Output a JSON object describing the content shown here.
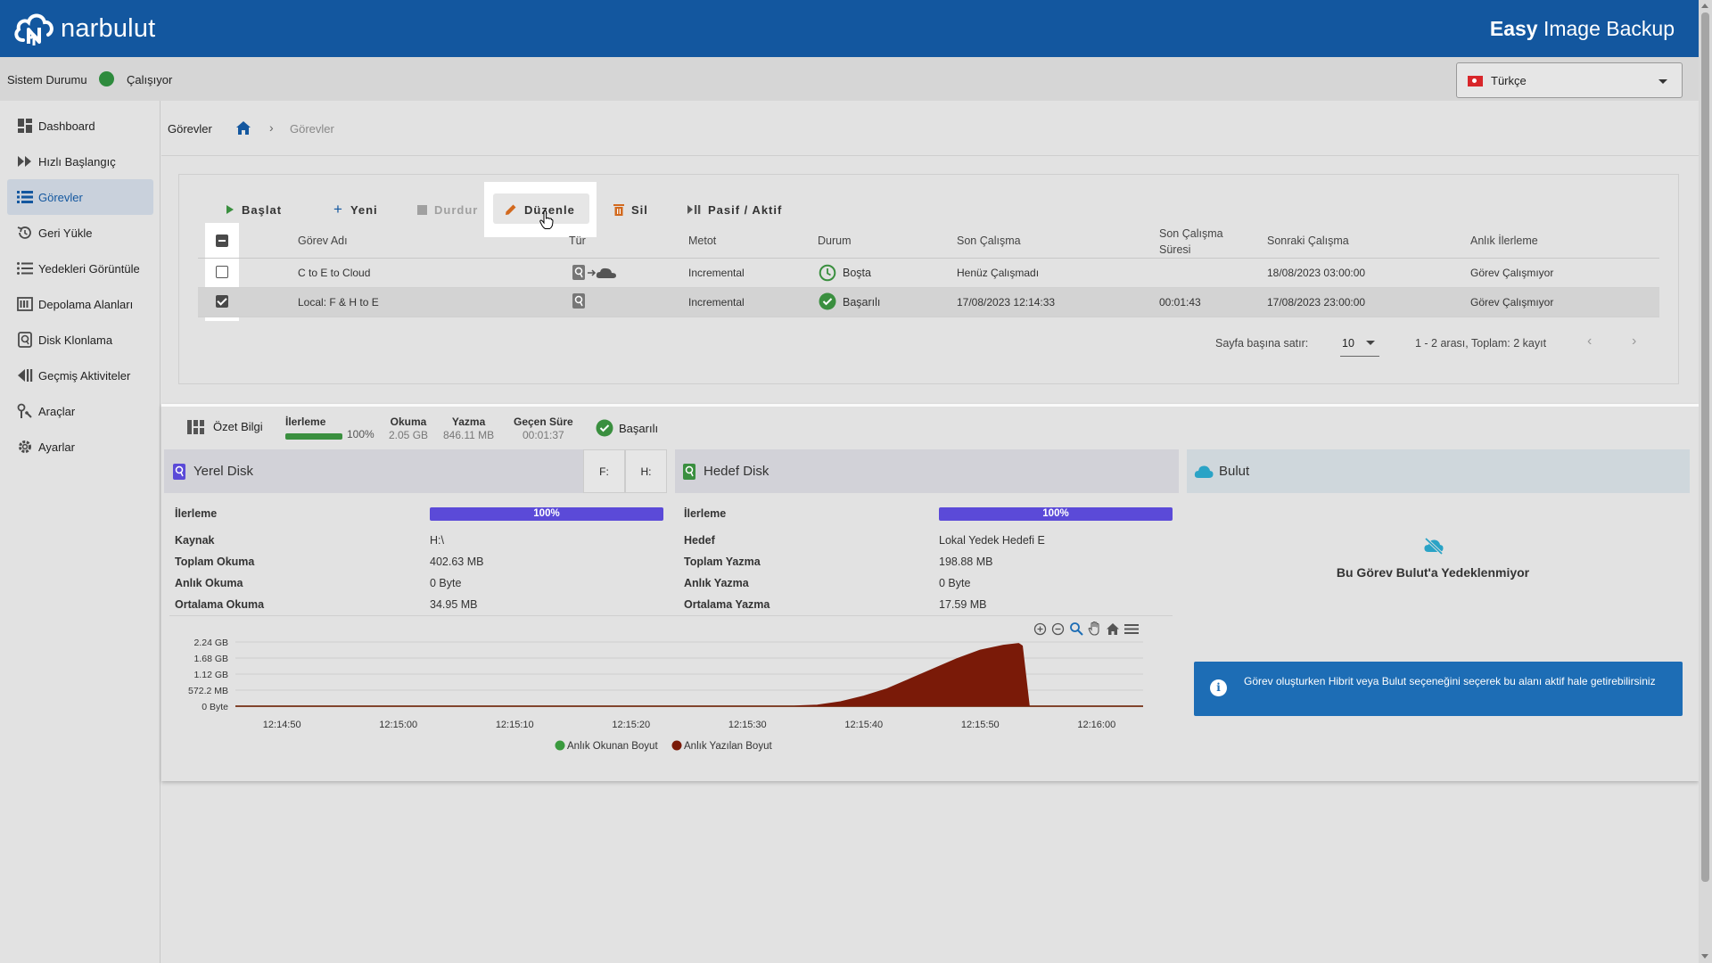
{
  "header": {
    "logo_text": "narbulut",
    "app_title_bold": "Easy",
    "app_title_rest": " Image Backup"
  },
  "status": {
    "label": "Sistem Durumu",
    "state": "Çalışıyor",
    "state_color": "#2e8b3d"
  },
  "language": {
    "selected": "Türkçe"
  },
  "sidebar": {
    "items": [
      {
        "label": "Dashboard",
        "icon": "dashboard-icon"
      },
      {
        "label": "Hızlı Başlangıç",
        "icon": "fast-forward-icon"
      },
      {
        "label": "Görevler",
        "icon": "list-icon",
        "active": true
      },
      {
        "label": "Geri Yükle",
        "icon": "restore-icon"
      },
      {
        "label": "Yedekleri Görüntüle",
        "icon": "view-list-icon"
      },
      {
        "label": "Depolama Alanları",
        "icon": "storage-icon"
      },
      {
        "label": "Disk Klonlama",
        "icon": "disk-icon"
      },
      {
        "label": "Geçmiş Aktiviteler",
        "icon": "history-icon"
      },
      {
        "label": "Araçlar",
        "icon": "tools-icon"
      },
      {
        "label": "Ayarlar",
        "icon": "settings-icon"
      }
    ]
  },
  "breadcrumb": {
    "title": "Görevler",
    "current": "Görevler"
  },
  "toolbar": {
    "start": "Başlat",
    "new": "Yeni",
    "stop": "Durdur",
    "edit": "Düzenle",
    "delete": "Sil",
    "toggle": "Pasif / Aktif"
  },
  "table": {
    "headers": {
      "name": "Görev Adı",
      "type": "Tür",
      "method": "Metot",
      "status": "Durum",
      "last_run": "Son Çalışma",
      "last_duration_1": "Son Çalışma",
      "last_duration_2": "Süresi",
      "next_run": "Sonraki Çalışma",
      "progress": "Anlık İlerleme"
    },
    "rows": [
      {
        "checked": false,
        "name": "C to E to Cloud",
        "method": "Incremental",
        "status": "Boşta",
        "last_run": "Henüz Çalışmadı",
        "duration": "",
        "next_run": "18/08/2023 03:00:00",
        "progress": "Görev Çalışmıyor"
      },
      {
        "checked": true,
        "name": "Local: F & H to E",
        "method": "Incremental",
        "status": "Başarılı",
        "last_run": "17/08/2023 12:14:33",
        "duration": "00:01:43",
        "next_run": "17/08/2023 23:00:00",
        "progress": "Görev Çalışmıyor"
      }
    ],
    "rows_per_page_label": "Sayfa başına satır:",
    "rows_per_page": "10",
    "page_info": "1 - 2 arası, Toplam: 2 kayıt"
  },
  "summary": {
    "title": "Özet Bilgi",
    "progress_label": "İlerleme",
    "progress_value": "100%",
    "progress_fraction": 1.0,
    "read_label": "Okuma",
    "read_value": "2.05 GB",
    "write_label": "Yazma",
    "write_value": "846.11 MB",
    "elapsed_label": "Geçen Süre",
    "elapsed_value": "00:01:37",
    "result": "Başarılı"
  },
  "local_disk": {
    "title": "Yerel Disk",
    "drives": [
      "F:",
      "H:"
    ],
    "progress_label": "İlerleme",
    "progress_value": "100%",
    "source_label": "Kaynak",
    "source": "H:\\",
    "total_read_label": "Toplam Okuma",
    "total_read": "402.63 MB",
    "instant_read_label": "Anlık Okuma",
    "instant_read": "0 Byte",
    "avg_read_label": "Ortalama Okuma",
    "avg_read": "34.95 MB"
  },
  "target_disk": {
    "title": "Hedef Disk",
    "progress_label": "İlerleme",
    "progress_value": "100%",
    "target_label": "Hedef",
    "target": "Lokal Yedek Hedefi E",
    "total_write_label": "Toplam Yazma",
    "total_write": "198.88 MB",
    "instant_write_label": "Anlık Yazma",
    "instant_write": "0 Byte",
    "avg_write_label": "Ortalama Yazma",
    "avg_write": "17.59 MB"
  },
  "cloud": {
    "title": "Bulut",
    "message": "Bu Görev Bulut'a Yedeklenmiyor",
    "info": "Görev oluşturken Hibrit veya Bulut seçeneğini seçerek bu alanı aktif hale getirebilirsiniz"
  },
  "chart_data": {
    "type": "area",
    "x_ticks": [
      "12:14:50",
      "12:15:00",
      "12:15:10",
      "12:15:20",
      "12:15:30",
      "12:15:40",
      "12:15:50",
      "12:16:00"
    ],
    "y_ticks": [
      "2.24 GB",
      "1.68 GB",
      "1.12 GB",
      "572.2 MB",
      "0 Byte"
    ],
    "y_max_gb": 2.24,
    "x_start_s": 46,
    "x_end_s": 124,
    "series": [
      {
        "name": "Anlık Okunan Boyut",
        "color": "#3a9a3e",
        "points": [
          [
            46,
            0
          ],
          [
            124,
            0
          ]
        ]
      },
      {
        "name": "Anlık Yazılan Boyut",
        "color": "#7a1a08",
        "points": [
          [
            46,
            0
          ],
          [
            94,
            0
          ],
          [
            96,
            0.03
          ],
          [
            98,
            0.15
          ],
          [
            100,
            0.35
          ],
          [
            102,
            0.6
          ],
          [
            104,
            0.95
          ],
          [
            106,
            1.3
          ],
          [
            108,
            1.65
          ],
          [
            110,
            1.95
          ],
          [
            112,
            2.12
          ],
          [
            113.3,
            2.18
          ],
          [
            113.6,
            2.1
          ],
          [
            114.2,
            0
          ],
          [
            124,
            0
          ]
        ]
      }
    ]
  },
  "colors": {
    "brand": "#13579f",
    "progress": "#5b4ad8",
    "info": "#1d6db5"
  }
}
